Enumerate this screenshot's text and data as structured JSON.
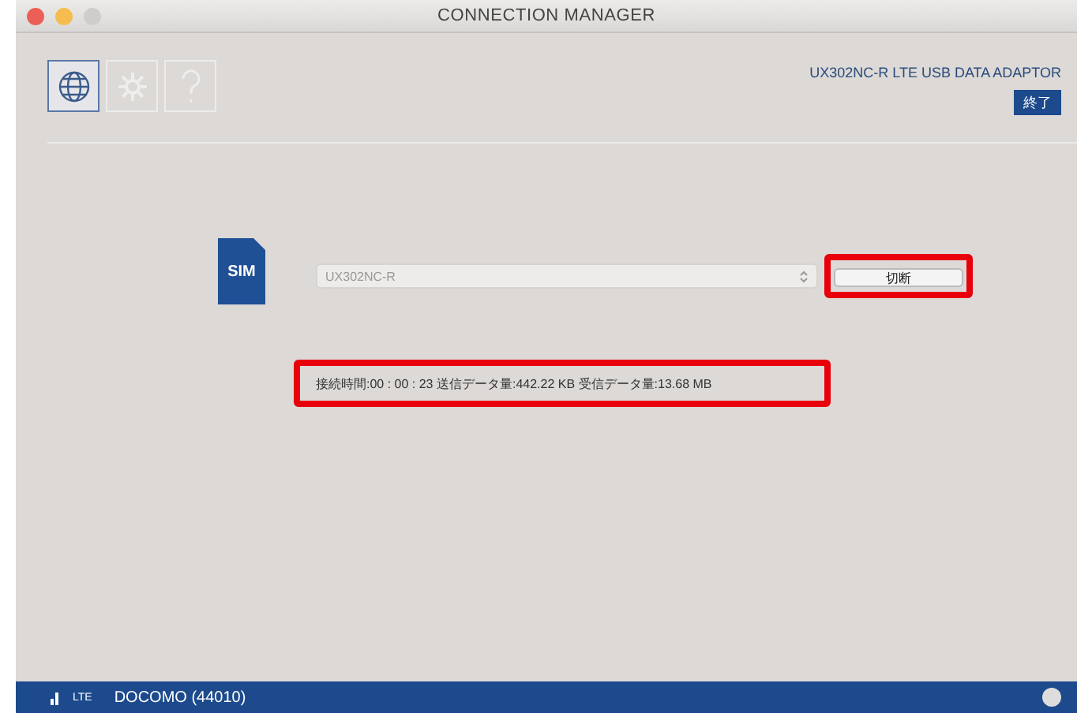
{
  "window": {
    "title": "CONNECTION MANAGER"
  },
  "toolbar": {
    "tabs": [
      {
        "kind": "globe",
        "selected": true,
        "disabled": false
      },
      {
        "kind": "gear",
        "selected": false,
        "disabled": true
      },
      {
        "kind": "help",
        "selected": false,
        "disabled": true
      }
    ]
  },
  "device_title": "UX302NC-R LTE USB DATA ADAPTOR",
  "quit_button": "終了",
  "sim_label": "SIM",
  "device_select": {
    "value": "UX302NC-R"
  },
  "disconnect_button": {
    "label": "切断",
    "highlighted": true
  },
  "stats": {
    "text": "接続時間:00 : 00 : 23  送信データ量:442.22 KB  受信データ量:13.68 MB",
    "highlighted": true
  },
  "status_bar": {
    "network": "LTE",
    "carrier": "DOCOMO (44010)"
  }
}
